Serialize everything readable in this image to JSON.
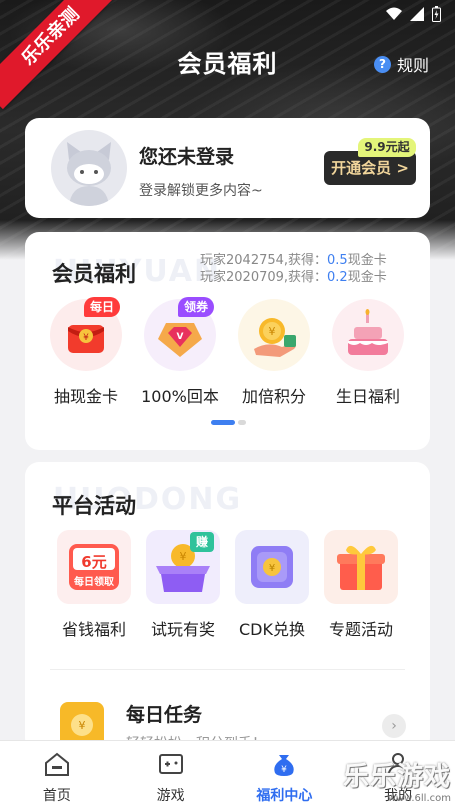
{
  "status_bar": {
    "icons": [
      "wifi-icon",
      "signal-icon",
      "battery-icon"
    ]
  },
  "ribbon": {
    "text": "乐乐亲测"
  },
  "header": {
    "title": "会员福利",
    "rules_label": "规则",
    "rules_icon": "question-icon"
  },
  "login_card": {
    "title": "您还未登录",
    "subtitle": "登录解锁更多内容~",
    "vip_button": "开通会员 >",
    "vip_tag": "9.9元起"
  },
  "benefits": {
    "title": "会员福利",
    "watermark": "HUIYUAN",
    "ticker": [
      {
        "prefix": "玩家2042754,获得：",
        "highlight": "0.5",
        "suffix": "现金卡"
      },
      {
        "prefix": "玩家2020709,获得：",
        "highlight": "0.2",
        "suffix": "现金卡"
      }
    ],
    "items": [
      {
        "label": "抽现金卡",
        "badge": "每日",
        "icon": "red-envelope-icon",
        "badge_color": "#ff3b3b"
      },
      {
        "label": "100%回本",
        "badge": "领券",
        "icon": "diamond-icon",
        "badge_color": "#9a4dff"
      },
      {
        "label": "加倍积分",
        "badge": "",
        "icon": "coin-hand-icon",
        "badge_color": ""
      },
      {
        "label": "生日福利",
        "badge": "",
        "icon": "birthday-cake-icon",
        "badge_color": ""
      }
    ]
  },
  "activities": {
    "title": "平台活动",
    "watermark": "HUODONG",
    "items": [
      {
        "label": "省钱福利",
        "icon": "coupon-6-icon",
        "icon_text_top": "6元",
        "icon_text_bottom": "每日领取"
      },
      {
        "label": "试玩有奖",
        "icon": "coin-box-icon",
        "badge": "赚"
      },
      {
        "label": "CDK兑换",
        "icon": "purple-envelope-icon"
      },
      {
        "label": "专题活动",
        "icon": "gift-box-icon"
      }
    ],
    "daily_task": {
      "title": "每日任务",
      "subtitle": "轻轻松松，积分到手！"
    }
  },
  "tabbar": {
    "tabs": [
      {
        "label": "首页",
        "icon": "home-icon",
        "active": false
      },
      {
        "label": "游戏",
        "icon": "gamepad-icon",
        "active": false
      },
      {
        "label": "福利中心",
        "icon": "money-bag-icon",
        "active": true
      },
      {
        "label": "我的",
        "icon": "profile-icon",
        "active": false
      }
    ]
  },
  "brand_watermark": {
    "text": "乐乐游戏",
    "url": "www.6ll.com"
  }
}
